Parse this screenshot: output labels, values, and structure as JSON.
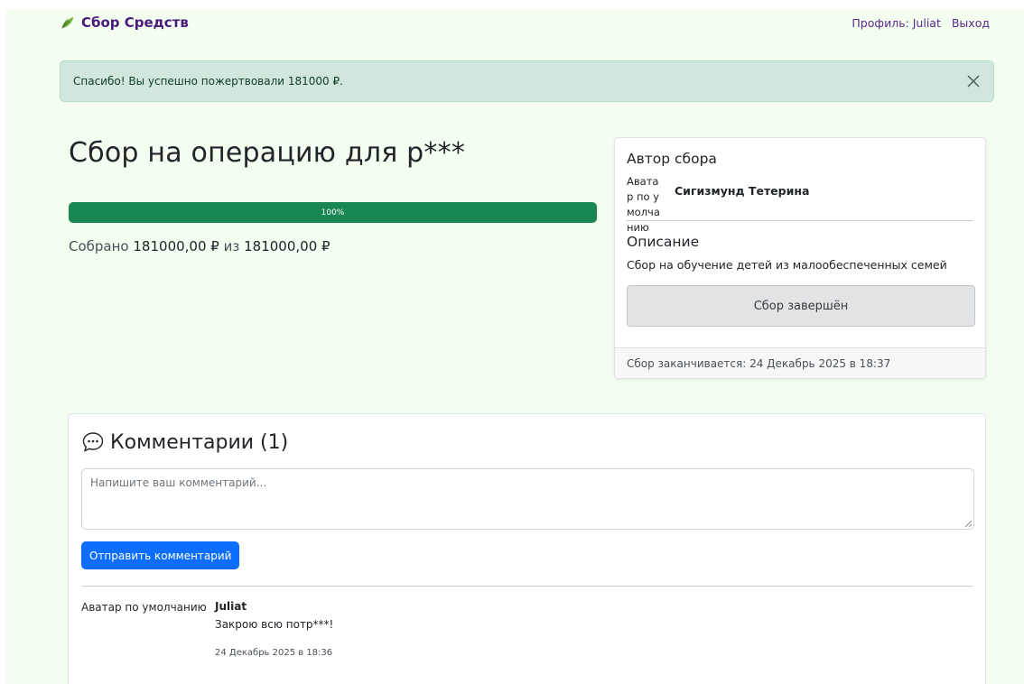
{
  "nav": {
    "brand": "Сбор Средств",
    "profile_link": "Профиль: Juliat",
    "logout_link": "Выход"
  },
  "alert": {
    "message": "Спасибо! Вы успешно пожертвовали 181000 ₽."
  },
  "campaign": {
    "title": "Сбор на операцию для р***",
    "progress_percent": 100,
    "progress_label": "100%",
    "collected_prefix": "Собрано",
    "collected_amount": "181000,00 ₽",
    "collected_sep": "из",
    "goal_amount": "181000,00 ₽"
  },
  "author_card": {
    "heading": "Автор сбора",
    "avatar_alt": "Аватар по умолчанию",
    "author_name": "Сигизмунд Тетерина",
    "description_heading": "Описание",
    "description": "Сбор на обучение детей из малообеспеченных семей",
    "status_button": "Сбор завершён",
    "footer": "Сбор заканчивается: 24 Декабрь 2025 в 18:37"
  },
  "comments": {
    "heading": "Комментарии (1)",
    "input_placeholder": "Напишите ваш комментарий...",
    "submit_label": "Отправить комментарий",
    "items": [
      {
        "avatar_alt": "Аватар по умолчанию",
        "author": "Juliat",
        "text": "Закрою всю потр***!",
        "date": "24 Декабрь 2025 в 18:36"
      }
    ]
  },
  "colors": {
    "page_bg": "#f3fdf0",
    "brand": "#4a1a7a",
    "success": "#198754",
    "primary": "#0d6efd",
    "alert_bg": "#d1e7dd"
  }
}
